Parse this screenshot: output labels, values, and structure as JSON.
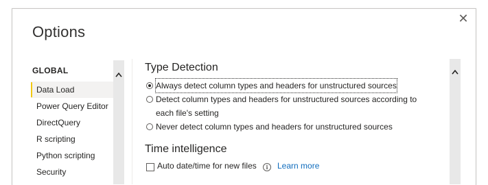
{
  "dialog": {
    "title": "Options",
    "close_icon": "close-icon"
  },
  "nav": {
    "header": "GLOBAL",
    "items": [
      {
        "label": "Data Load",
        "selected": true
      },
      {
        "label": "Power Query Editor",
        "selected": false
      },
      {
        "label": "DirectQuery",
        "selected": false
      },
      {
        "label": "R scripting",
        "selected": false
      },
      {
        "label": "Python scripting",
        "selected": false
      },
      {
        "label": "Security",
        "selected": false
      }
    ]
  },
  "type_detection": {
    "title": "Type Detection",
    "options": [
      {
        "label": "Always detect column types and headers for unstructured sources",
        "checked": true
      },
      {
        "label": "Detect column types and headers for unstructured sources according to each file's setting",
        "checked": false
      },
      {
        "label": "Never detect column types and headers for unstructured sources",
        "checked": false
      }
    ]
  },
  "time_intelligence": {
    "title": "Time intelligence",
    "auto_datetime_label": "Auto date/time for new files",
    "auto_datetime_checked": false,
    "info_icon": "info-icon",
    "learn_more": "Learn more"
  },
  "colors": {
    "accent": "#f2c811",
    "link": "#0f6cbd",
    "scrollbar": "#e8e8e8"
  }
}
